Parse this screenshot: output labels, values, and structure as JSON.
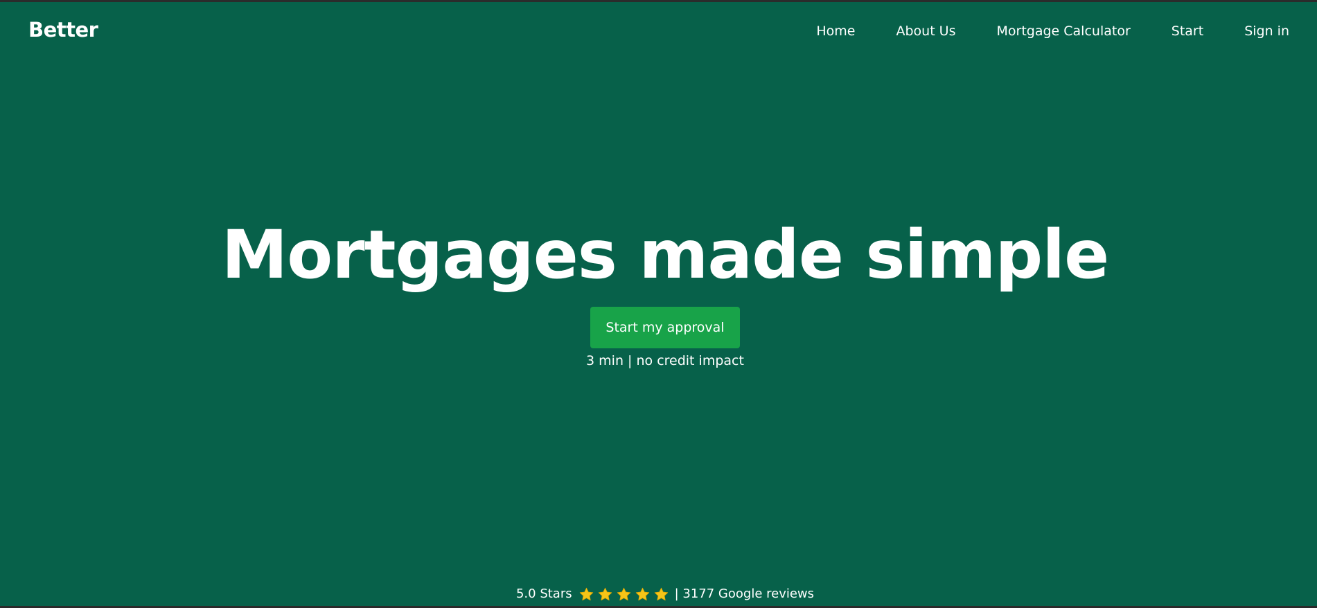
{
  "header": {
    "logo_text": "Better",
    "nav": [
      {
        "label": "Home"
      },
      {
        "label": "About Us"
      },
      {
        "label": "Mortgage Calculator"
      },
      {
        "label": "Start"
      },
      {
        "label": "Sign in"
      }
    ]
  },
  "hero": {
    "headline": "Mortgages made simple",
    "cta_label": "Start my approval",
    "subnote": "3 min | no credit impact"
  },
  "reviews": {
    "rating_text": "5.0 Stars",
    "star_count": 5,
    "star_icon": "star-icon",
    "reviews_text": "| 3177 Google reviews"
  },
  "colors": {
    "background": "#07614a",
    "cta": "#18a349",
    "text": "#ffffff",
    "star": "#f5c518",
    "frame": "#2b2b2b"
  }
}
